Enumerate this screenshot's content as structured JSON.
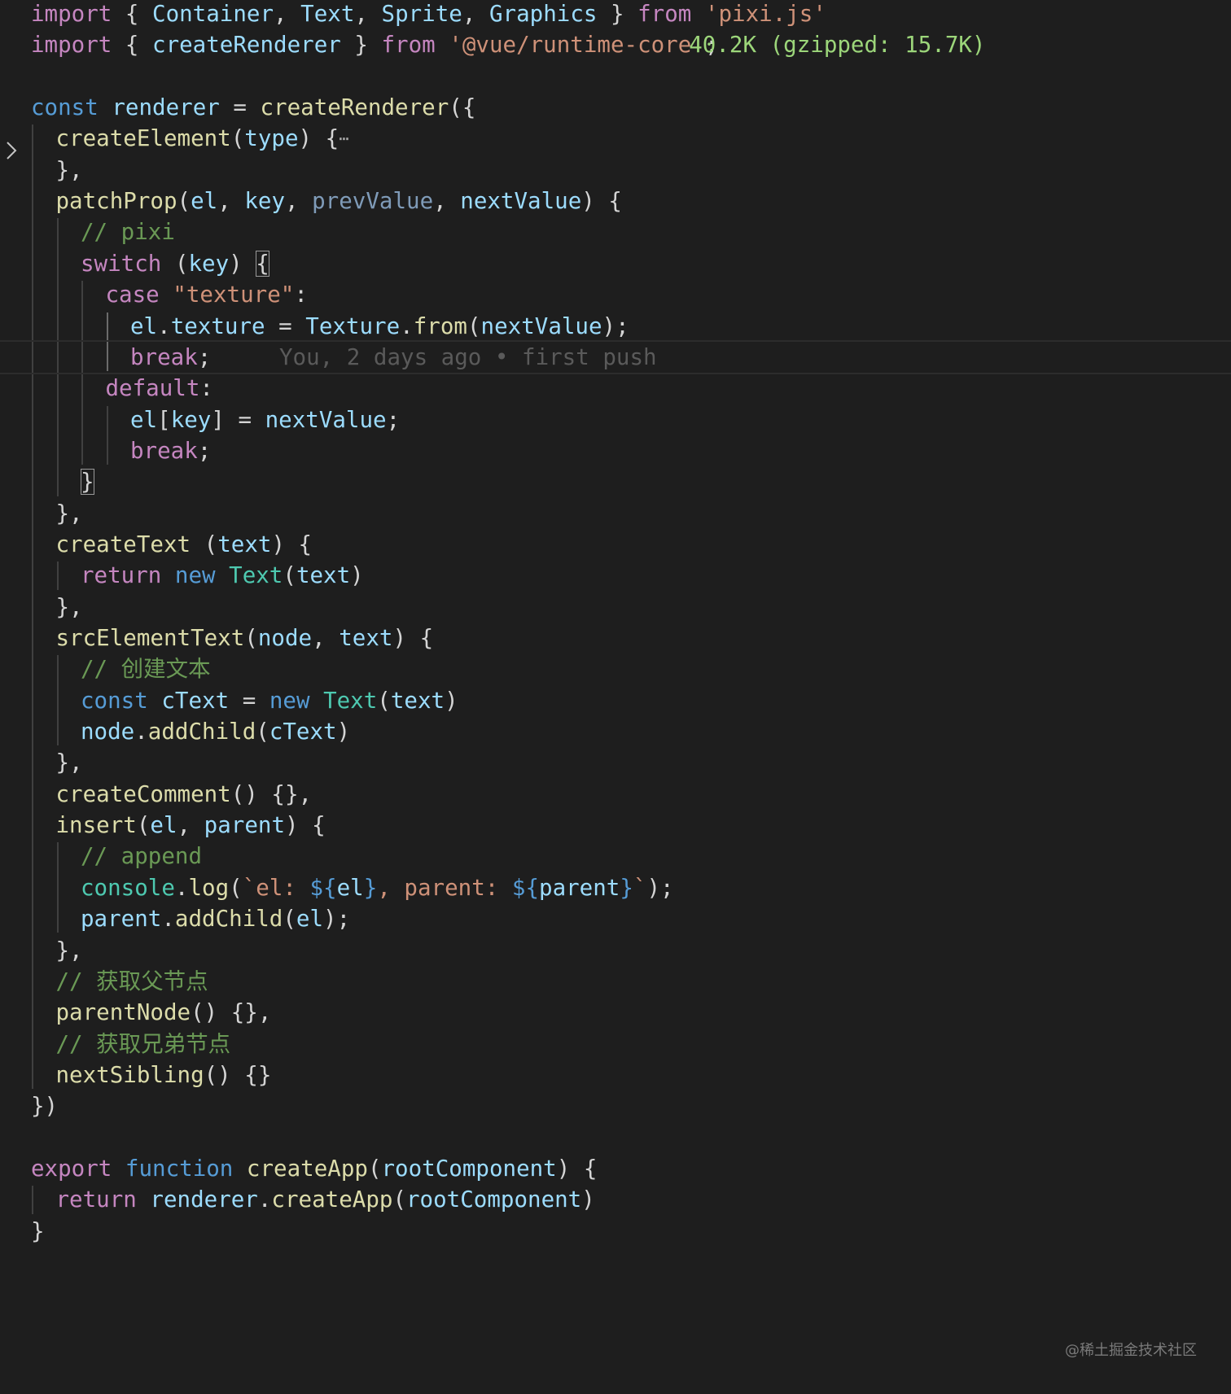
{
  "editor": {
    "background": "#1e1e1e",
    "colors": {
      "kw": "#c586c0",
      "st": "#ce9178",
      "vr": "#9cdcfe",
      "fn": "#dcdcaa",
      "pl": "#d4d4d4",
      "cm": "#6a9955",
      "bl": "#569cd6",
      "cl": "#4ec9b0",
      "dm": "#7f9bb8",
      "ty": "#b5cea8"
    },
    "lines": [
      {
        "indent": 0,
        "tokens": [
          [
            "kw",
            "import"
          ],
          [
            "pl",
            " { "
          ],
          [
            "vr",
            "Container"
          ],
          [
            "pl",
            ", "
          ],
          [
            "vr",
            "Text"
          ],
          [
            "pl",
            ", "
          ],
          [
            "vr",
            "Sprite"
          ],
          [
            "pl",
            ", "
          ],
          [
            "vr",
            "Graphics"
          ],
          [
            "pl",
            " } "
          ],
          [
            "kw",
            "from"
          ],
          [
            "pl",
            " "
          ],
          [
            "st",
            "'pixi.js'"
          ]
        ]
      },
      {
        "indent": 0,
        "tokens": [
          [
            "kw",
            "import"
          ],
          [
            "pl",
            " { "
          ],
          [
            "vr",
            "createRenderer"
          ],
          [
            "pl",
            " } "
          ],
          [
            "kw",
            "from"
          ],
          [
            "pl",
            " "
          ],
          [
            "st",
            "'@vue/runtime-core'"
          ],
          [
            "pl",
            ";"
          ]
        ],
        "size_hint": "40.2K (gzipped: 15.7K)"
      },
      {
        "indent": 0,
        "tokens": []
      },
      {
        "indent": 0,
        "tokens": [
          [
            "bl",
            "const"
          ],
          [
            "pl",
            " "
          ],
          [
            "vr",
            "renderer"
          ],
          [
            "pl",
            " = "
          ],
          [
            "fn",
            "createRenderer"
          ],
          [
            "pl",
            "({"
          ]
        ]
      },
      {
        "indent": 1,
        "tokens": [
          [
            "fn",
            "createElement"
          ],
          [
            "pl",
            "("
          ],
          [
            "vr",
            "type"
          ],
          [
            "pl",
            ") {"
          ]
        ],
        "folded": true
      },
      {
        "indent": 1,
        "tokens": [
          [
            "pl",
            "},"
          ]
        ]
      },
      {
        "indent": 1,
        "tokens": [
          [
            "fn",
            "patchProp"
          ],
          [
            "pl",
            "("
          ],
          [
            "vr",
            "el"
          ],
          [
            "pl",
            ", "
          ],
          [
            "vr",
            "key"
          ],
          [
            "pl",
            ", "
          ],
          [
            "dm",
            "prevValue"
          ],
          [
            "pl",
            ", "
          ],
          [
            "vr",
            "nextValue"
          ],
          [
            "pl",
            ") {"
          ]
        ]
      },
      {
        "indent": 2,
        "tokens": [
          [
            "cm",
            "// pixi"
          ]
        ]
      },
      {
        "indent": 2,
        "tokens": [
          [
            "kw",
            "switch"
          ],
          [
            "pl",
            " ("
          ],
          [
            "vr",
            "key"
          ],
          [
            "pl",
            ") "
          ],
          [
            "box",
            "{"
          ]
        ]
      },
      {
        "indent": 3,
        "tokens": [
          [
            "kw",
            "case"
          ],
          [
            "pl",
            " "
          ],
          [
            "st",
            "\"texture\""
          ],
          [
            "pl",
            ":"
          ]
        ]
      },
      {
        "indent": 4,
        "tokens": [
          [
            "vr",
            "el"
          ],
          [
            "pl",
            "."
          ],
          [
            "vr",
            "texture"
          ],
          [
            "pl",
            " = "
          ],
          [
            "vr",
            "Texture"
          ],
          [
            "pl",
            "."
          ],
          [
            "fn",
            "from"
          ],
          [
            "pl",
            "("
          ],
          [
            "vr",
            "nextValue"
          ],
          [
            "pl",
            ");"
          ]
        ]
      },
      {
        "indent": 4,
        "tokens": [
          [
            "kw",
            "break"
          ],
          [
            "pl",
            ";"
          ]
        ],
        "blame": "You, 2 days ago • first push",
        "current": true
      },
      {
        "indent": 3,
        "tokens": [
          [
            "kw",
            "default"
          ],
          [
            "pl",
            ":"
          ]
        ]
      },
      {
        "indent": 4,
        "tokens": [
          [
            "vr",
            "el"
          ],
          [
            "pl",
            "["
          ],
          [
            "vr",
            "key"
          ],
          [
            "pl",
            "] = "
          ],
          [
            "vr",
            "nextValue"
          ],
          [
            "pl",
            ";"
          ]
        ]
      },
      {
        "indent": 4,
        "tokens": [
          [
            "kw",
            "break"
          ],
          [
            "pl",
            ";"
          ]
        ]
      },
      {
        "indent": 2,
        "tokens": [
          [
            "box",
            "}"
          ]
        ]
      },
      {
        "indent": 1,
        "tokens": [
          [
            "pl",
            "},"
          ]
        ]
      },
      {
        "indent": 1,
        "tokens": [
          [
            "fn",
            "createText"
          ],
          [
            "pl",
            " ("
          ],
          [
            "vr",
            "text"
          ],
          [
            "pl",
            ") {"
          ]
        ]
      },
      {
        "indent": 2,
        "tokens": [
          [
            "kw",
            "return"
          ],
          [
            "pl",
            " "
          ],
          [
            "bl",
            "new"
          ],
          [
            "pl",
            " "
          ],
          [
            "cl",
            "Text"
          ],
          [
            "pl",
            "("
          ],
          [
            "vr",
            "text"
          ],
          [
            "pl",
            ")"
          ]
        ]
      },
      {
        "indent": 1,
        "tokens": [
          [
            "pl",
            "},"
          ]
        ]
      },
      {
        "indent": 1,
        "tokens": [
          [
            "fn",
            "srcElementText"
          ],
          [
            "pl",
            "("
          ],
          [
            "vr",
            "node"
          ],
          [
            "pl",
            ", "
          ],
          [
            "vr",
            "text"
          ],
          [
            "pl",
            ") {"
          ]
        ]
      },
      {
        "indent": 2,
        "tokens": [
          [
            "cm",
            "// 创建文本"
          ]
        ]
      },
      {
        "indent": 2,
        "tokens": [
          [
            "bl",
            "const"
          ],
          [
            "pl",
            " "
          ],
          [
            "vr",
            "cText"
          ],
          [
            "pl",
            " = "
          ],
          [
            "bl",
            "new"
          ],
          [
            "pl",
            " "
          ],
          [
            "cl",
            "Text"
          ],
          [
            "pl",
            "("
          ],
          [
            "vr",
            "text"
          ],
          [
            "pl",
            ")"
          ]
        ]
      },
      {
        "indent": 2,
        "tokens": [
          [
            "vr",
            "node"
          ],
          [
            "pl",
            "."
          ],
          [
            "fn",
            "addChild"
          ],
          [
            "pl",
            "("
          ],
          [
            "vr",
            "cText"
          ],
          [
            "pl",
            ")"
          ]
        ]
      },
      {
        "indent": 1,
        "tokens": [
          [
            "pl",
            "},"
          ]
        ]
      },
      {
        "indent": 1,
        "tokens": [
          [
            "fn",
            "createComment"
          ],
          [
            "pl",
            "() {},"
          ]
        ]
      },
      {
        "indent": 1,
        "tokens": [
          [
            "fn",
            "insert"
          ],
          [
            "pl",
            "("
          ],
          [
            "vr",
            "el"
          ],
          [
            "pl",
            ", "
          ],
          [
            "vr",
            "parent"
          ],
          [
            "pl",
            ") {"
          ]
        ]
      },
      {
        "indent": 2,
        "tokens": [
          [
            "cm",
            "// append"
          ]
        ]
      },
      {
        "indent": 2,
        "tokens": [
          [
            "cl",
            "console"
          ],
          [
            "pl",
            "."
          ],
          [
            "fn",
            "log"
          ],
          [
            "pl",
            "("
          ],
          [
            "st",
            "`el: "
          ],
          [
            "bl",
            "${"
          ],
          [
            "vr",
            "el"
          ],
          [
            "bl",
            "}"
          ],
          [
            "st",
            ", parent: "
          ],
          [
            "bl",
            "${"
          ],
          [
            "vr",
            "parent"
          ],
          [
            "bl",
            "}"
          ],
          [
            "st",
            "`"
          ],
          [
            "pl",
            ");"
          ]
        ]
      },
      {
        "indent": 2,
        "tokens": [
          [
            "vr",
            "parent"
          ],
          [
            "pl",
            "."
          ],
          [
            "fn",
            "addChild"
          ],
          [
            "pl",
            "("
          ],
          [
            "vr",
            "el"
          ],
          [
            "pl",
            ");"
          ]
        ]
      },
      {
        "indent": 1,
        "tokens": [
          [
            "pl",
            "},"
          ]
        ]
      },
      {
        "indent": 1,
        "tokens": [
          [
            "cm",
            "// 获取父节点"
          ]
        ]
      },
      {
        "indent": 1,
        "tokens": [
          [
            "fn",
            "parentNode"
          ],
          [
            "pl",
            "() {},"
          ]
        ]
      },
      {
        "indent": 1,
        "tokens": [
          [
            "cm",
            "// 获取兄弟节点"
          ]
        ]
      },
      {
        "indent": 1,
        "tokens": [
          [
            "fn",
            "nextSibling"
          ],
          [
            "pl",
            "() {}"
          ]
        ]
      },
      {
        "indent": 0,
        "tokens": [
          [
            "pl",
            "})"
          ]
        ]
      },
      {
        "indent": 0,
        "tokens": []
      },
      {
        "indent": 0,
        "tokens": [
          [
            "kw",
            "export"
          ],
          [
            "pl",
            " "
          ],
          [
            "bl",
            "function"
          ],
          [
            "pl",
            " "
          ],
          [
            "fn",
            "createApp"
          ],
          [
            "pl",
            "("
          ],
          [
            "vr",
            "rootComponent"
          ],
          [
            "pl",
            ") {"
          ]
        ]
      },
      {
        "indent": 1,
        "tokens": [
          [
            "kw",
            "return"
          ],
          [
            "pl",
            " "
          ],
          [
            "vr",
            "renderer"
          ],
          [
            "pl",
            "."
          ],
          [
            "fn",
            "createApp"
          ],
          [
            "pl",
            "("
          ],
          [
            "vr",
            "rootComponent"
          ],
          [
            "pl",
            ")"
          ]
        ]
      },
      {
        "indent": 0,
        "tokens": [
          [
            "pl",
            "}"
          ]
        ]
      }
    ]
  },
  "fold_icon": "chevron-right-icon",
  "folded_marker": "⋯",
  "watermark": "@稀土掘金技术社区"
}
